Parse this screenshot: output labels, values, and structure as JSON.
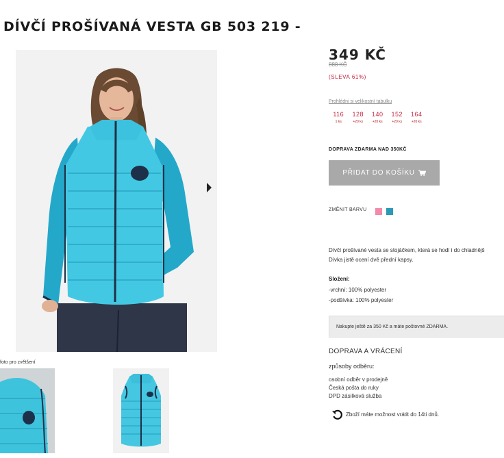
{
  "product": {
    "title": "DÍVČÍ PROŠÍVANÁ VESTA GB 503 219 -",
    "price": "349 KČ",
    "old_price": "888 KČ",
    "discount": "(SLEVA 61%)"
  },
  "gallery": {
    "zoom_hint": "foto pro zvětšení",
    "main_image_alt": "Dívka v tyrkysové prošívané vestě",
    "thumbnails": [
      "Detail vesty",
      "Vesta zepředu"
    ]
  },
  "sizes": {
    "table_link": "Prohlédni si velikostní tabulku",
    "items": [
      {
        "size": "116",
        "extra": "1 ks"
      },
      {
        "size": "128",
        "extra": "+20 ks"
      },
      {
        "size": "140",
        "extra": "+20 ks"
      },
      {
        "size": "152",
        "extra": "+20 ks"
      },
      {
        "size": "164",
        "extra": "+20 ks"
      }
    ]
  },
  "cart": {
    "free_shipping": "DOPRAVA ZDARMA NAD 350KČ",
    "add_to_cart_label": "PŘIDAT DO KOŠÍKU",
    "icon": "cart-icon"
  },
  "colors": {
    "label": "ZMĚNIT BARVU",
    "swatches": [
      "#f38aa9",
      "#2c9ab5"
    ]
  },
  "description": {
    "line1": "Dívčí prošívané vesta se stojáčkem, která se hodí i do chladnějš",
    "line2": "Dívka jistě ocení dvě přední kapsy."
  },
  "composition": {
    "heading": "Složení:",
    "outer": "-vrchní: 100% polyester",
    "lining": "-podšívka: 100% polyester"
  },
  "notice": "Nakupte ještě za 350 Kč a máte poštovné ZDARMA.",
  "shipping": {
    "heading": "DOPRAVA A VRÁCENÍ",
    "subheading": "způsoby odběru:",
    "methods": [
      "osobní odběr v prodejně",
      "Česká pošta do ruky",
      "DPD zásilková služba"
    ],
    "return_text": "Zboží máte možnost vrátit do 14ti dnů."
  }
}
